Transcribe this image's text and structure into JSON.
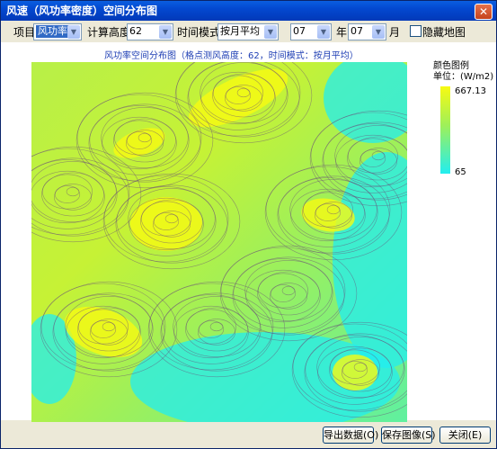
{
  "window": {
    "title": "风速（风功率密度）空间分布图",
    "close_glyph": "✕"
  },
  "toolbar": {
    "item_label": "项目",
    "item_value": "风功率",
    "height_label": "计算高度",
    "height_value": "62",
    "time_mode_label": "时间模式",
    "time_mode_value": "按月平均",
    "year_value": "07",
    "year_label": "年",
    "month_value": "07",
    "month_label": "月",
    "hide_map_label": "隐藏地图",
    "hide_map_checked": false,
    "dropdown_glyph": "▼"
  },
  "map": {
    "title": "风功率空间分布图（格点测风高度：62，时间模式：按月平均）",
    "colors": {
      "low": "#22eef0",
      "mid": "#9ef05a",
      "high": "#f8fa12",
      "contour": "#6a4a7a"
    }
  },
  "legend": {
    "title": "颜色图例",
    "unit": "单位：(W/m2)",
    "max": "667.13",
    "min": "65"
  },
  "buttons": {
    "export": "导出数据(O)",
    "save": "保存图像(S)",
    "close": "关闭(E)"
  }
}
